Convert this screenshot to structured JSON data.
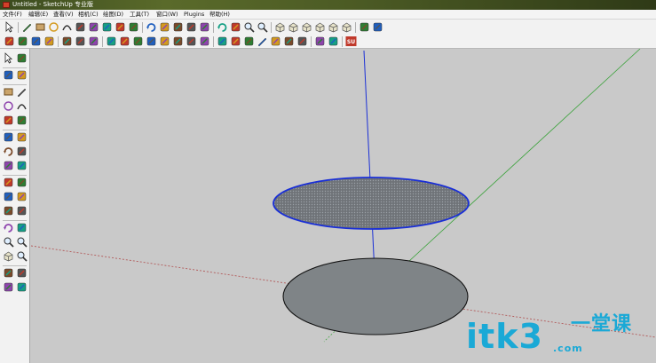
{
  "window": {
    "title": "Untitled - SketchUp 专业版"
  },
  "menu": {
    "items": [
      "文件(F)",
      "编辑(E)",
      "查看(V)",
      "相机(C)",
      "绘图(D)",
      "工具(T)",
      "窗口(W)",
      "Plugins",
      "帮助(H)"
    ]
  },
  "toolbar": {
    "row1_icons": [
      "select-icon",
      "pencil-icon",
      "rectangle-icon",
      "circle-icon",
      "arc-icon",
      "eraser-icon",
      "paint-bucket-icon",
      "push-pull-icon",
      "move-icon",
      "offset-icon",
      "rotate-icon",
      "follow-me-icon",
      "scale-icon",
      "tape-measure-icon",
      "text-icon",
      "orbit-icon",
      "pan-icon",
      "zoom-icon",
      "zoom-extents-icon",
      "iso-view-icon",
      "top-view-icon",
      "front-view-icon",
      "right-view-icon",
      "back-view-icon",
      "left-view-icon",
      "component-icon",
      "materials-icon"
    ],
    "row2_icons": [
      "axes-icon",
      "dimension-icon",
      "protractor-icon",
      "section-plane-icon",
      "walk-icon",
      "look-around-icon",
      "position-camera-icon",
      "sandbox-icon",
      "from-contours-icon",
      "from-scratch-icon",
      "smoove-icon",
      "stamp-icon",
      "drape-icon",
      "add-detail-icon",
      "flip-edge-icon",
      "xray-icon",
      "back-edges-icon",
      "wireframe-icon",
      "hidden-line-icon",
      "shaded-icon",
      "textured-icon",
      "monochrome-icon",
      "shadows-icon",
      "fog-icon",
      "plugin-su-icon"
    ],
    "plugin_badge": "SU"
  },
  "left_tools": {
    "icons": [
      "select-icon",
      "make-component-icon",
      "eraser-icon",
      "paint-bucket-icon",
      "rectangle-icon",
      "line-icon",
      "circle-icon",
      "arc-icon",
      "polygon-icon",
      "freehand-icon",
      "move-icon",
      "push-pull-icon",
      "rotate-icon",
      "follow-me-icon",
      "scale-icon",
      "offset-icon",
      "tape-measure-icon",
      "dimension-icon",
      "protractor-icon",
      "text-icon",
      "axes-icon",
      "3d-text-icon",
      "orbit-icon",
      "pan-icon",
      "zoom-icon",
      "zoom-window-icon",
      "previous-view-icon",
      "zoom-extents-icon",
      "position-camera-icon",
      "look-around-icon",
      "walk-icon",
      "section-plane-icon"
    ]
  },
  "colors": {
    "viewport_bg": "#c9c9c9",
    "axis_red": "#b25a5a",
    "axis_green": "#3aa23a",
    "axis_blue": "#1a2fd6",
    "face_fill": "#7f8487",
    "selection_edge": "#1a2fd6",
    "watermark": "#1aa9d6"
  },
  "watermark": {
    "brand": "itk3",
    "cn": "一堂课",
    "url": ".com"
  }
}
